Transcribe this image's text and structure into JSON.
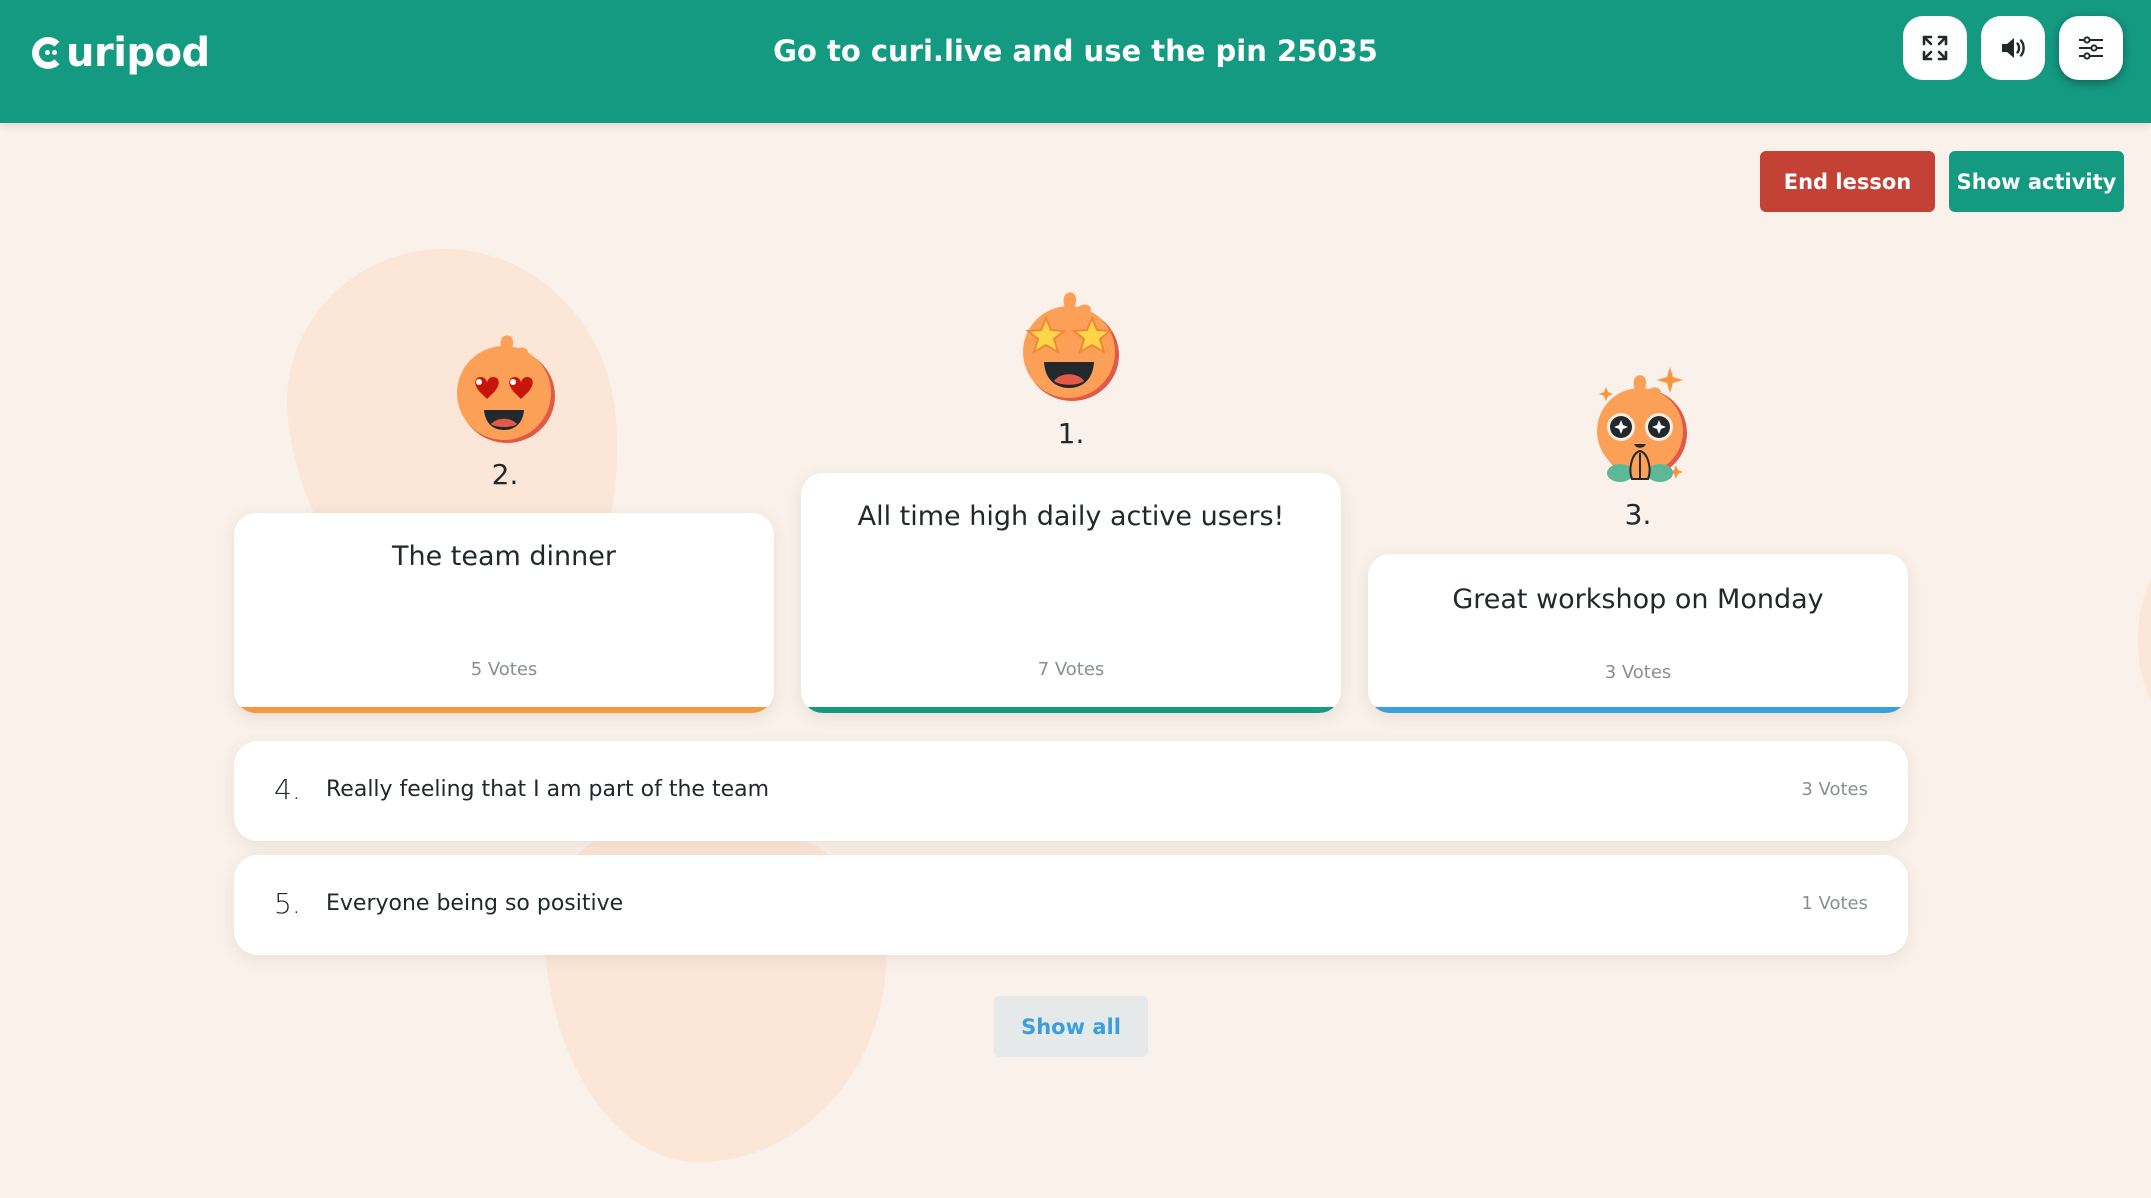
{
  "header": {
    "logo_text": "uripod",
    "title": "Go to curi.live and use the pin 25035",
    "buttons": [
      {
        "name": "fullscreen",
        "icon": "expand-icon"
      },
      {
        "name": "sound",
        "icon": "speaker-icon"
      },
      {
        "name": "settings",
        "icon": "sliders-icon"
      }
    ]
  },
  "actions": {
    "end_lesson": "End lesson",
    "show_activity": "Show activity"
  },
  "podium": [
    {
      "rank": "1.",
      "title": "All time high daily active users!",
      "votes": "7 Votes",
      "mascot": "star-eyes-mascot-icon",
      "accent": "#159a82"
    },
    {
      "rank": "2.",
      "title": "The team dinner",
      "votes": "5 Votes",
      "mascot": "heart-eyes-mascot-icon",
      "accent": "#f99640"
    },
    {
      "rank": "3.",
      "title": "Great workshop on Monday",
      "votes": "3 Votes",
      "mascot": "sparkle-eyes-mascot-icon",
      "accent": "#3a9fdc"
    }
  ],
  "list": [
    {
      "rank": "4.",
      "title": "Really feeling that I am part of the team",
      "votes": "3 Votes"
    },
    {
      "rank": "5.",
      "title": "Everyone being so positive",
      "votes": "1 Votes"
    }
  ],
  "show_all": "Show all",
  "colors": {
    "brand": "#159a82",
    "danger": "#c44136",
    "background": "#f9f1ea",
    "link": "#3a9fdc"
  }
}
